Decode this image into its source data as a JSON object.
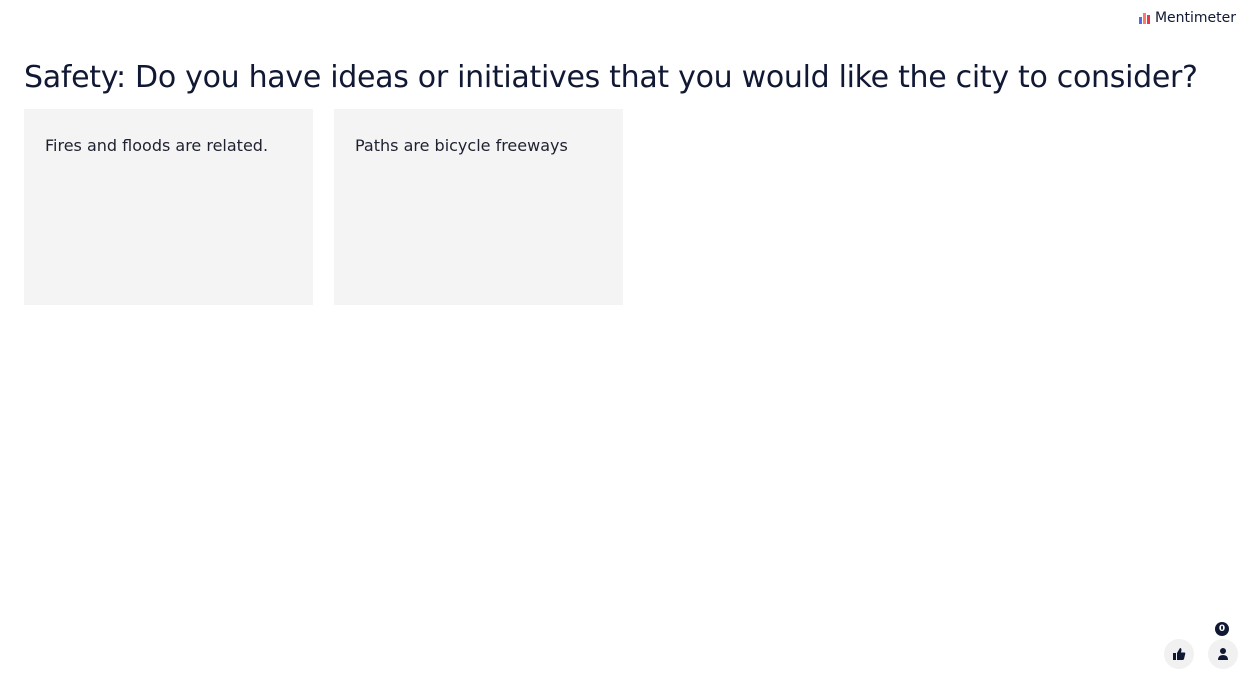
{
  "brand": {
    "name": "Mentimeter"
  },
  "question": {
    "title": "Safety: Do you have ideas or initiatives that you would like the city to consider?"
  },
  "responses": [
    {
      "text": "Fires and floods are related."
    },
    {
      "text": "Paths are bicycle freeways"
    }
  ],
  "controls": {
    "reactions_icon": "thumbs-up-icon",
    "participants_icon": "person-icon",
    "participant_count": "0"
  },
  "colors": {
    "card_background": "#f4f4f4",
    "text": "#101834",
    "logo_blue": "#5769e7",
    "logo_coral": "#ff7a6b",
    "logo_red": "#e8364f"
  }
}
